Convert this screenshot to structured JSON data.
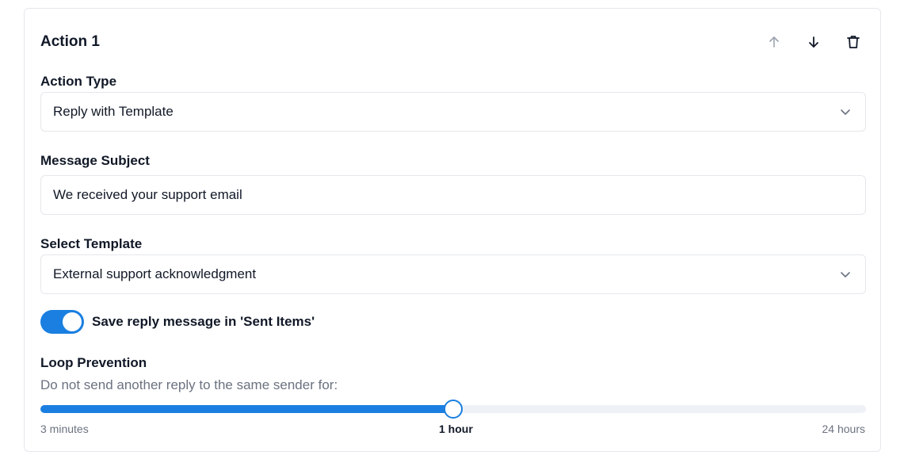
{
  "card": {
    "title": "Action 1",
    "toolbar": {
      "move_up_icon": "arrow-up-icon",
      "move_down_icon": "arrow-down-icon",
      "delete_icon": "trash-icon"
    }
  },
  "action_type": {
    "label": "Action Type",
    "value": "Reply with Template"
  },
  "message_subject": {
    "label": "Message Subject",
    "value": "We received your support email"
  },
  "select_template": {
    "label": "Select Template",
    "value": "External support acknowledgment"
  },
  "save_reply": {
    "label": "Save reply message in 'Sent Items'",
    "enabled": true
  },
  "loop_prevention": {
    "label": "Loop Prevention",
    "description": "Do not send another reply to the same sender for:",
    "min_label": "3 minutes",
    "current_label": "1 hour",
    "max_label": "24 hours",
    "fraction": 0.5
  },
  "colors": {
    "accent": "#1a7fe0",
    "muted_text": "#6b7280",
    "border": "#e5e7eb"
  }
}
